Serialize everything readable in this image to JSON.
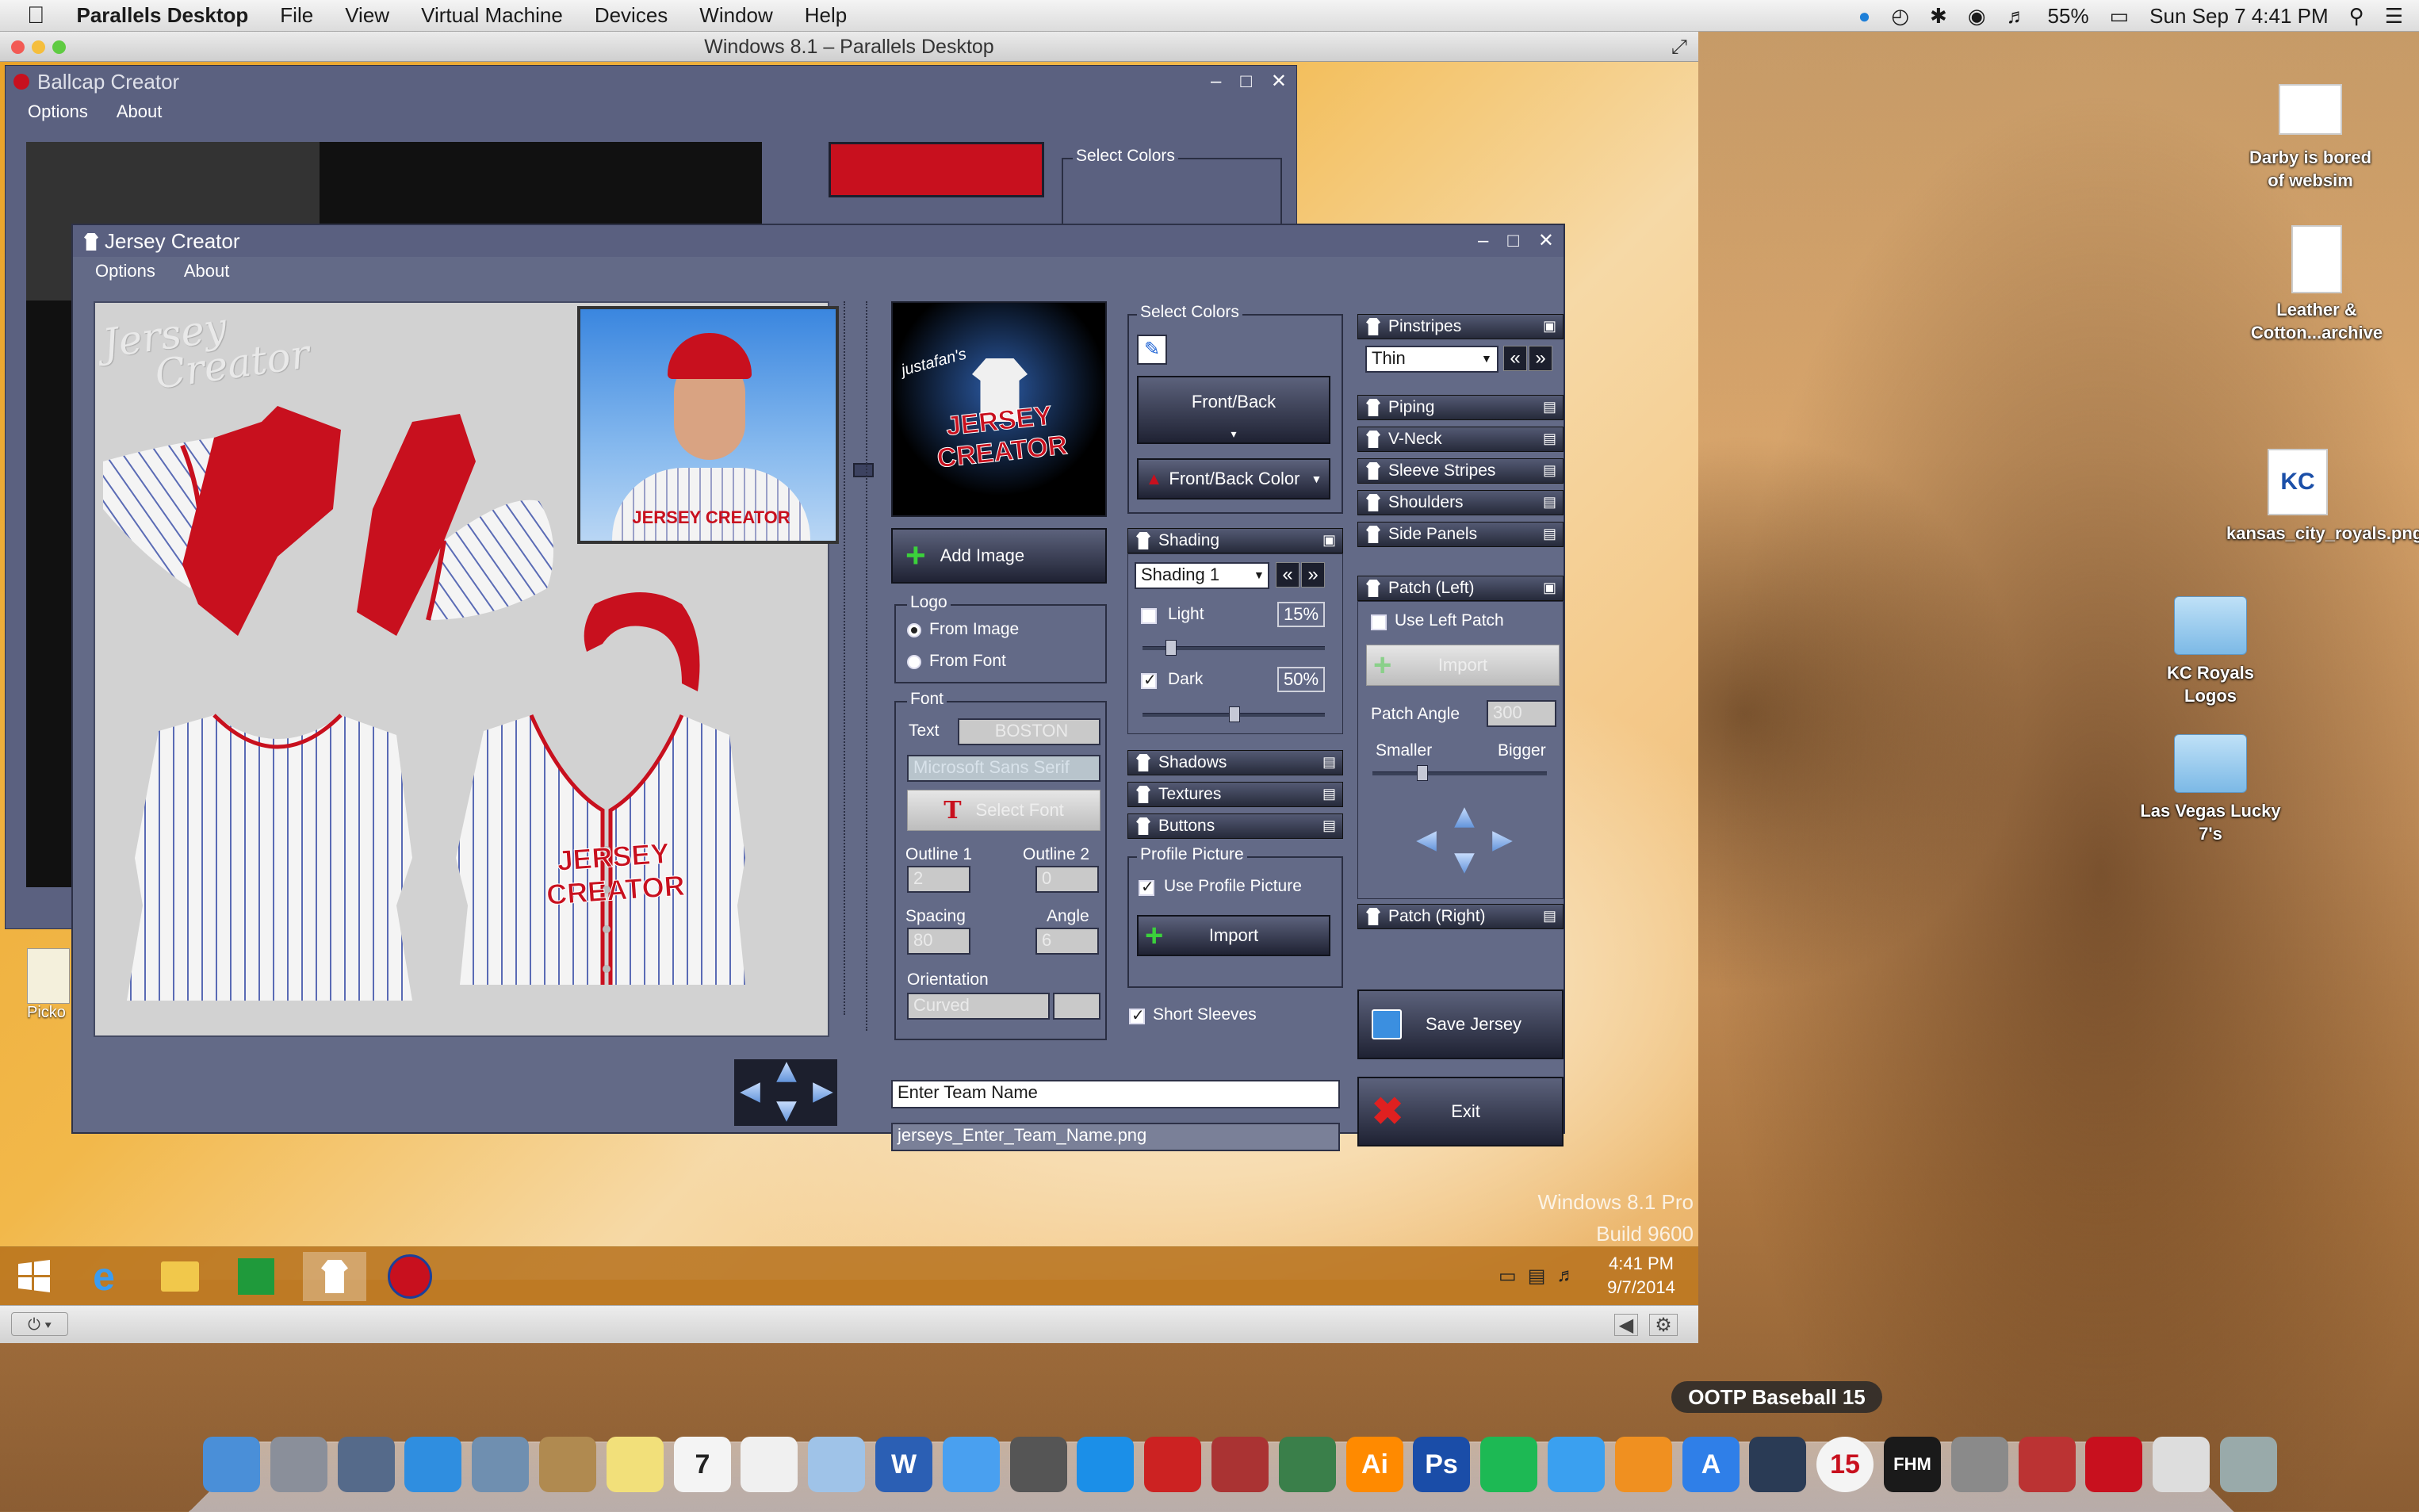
{
  "menubar": {
    "app": "Parallels Desktop",
    "items": [
      "File",
      "View",
      "Virtual Machine",
      "Devices",
      "Window",
      "Help"
    ],
    "battery": "55%",
    "clock": "Sun Sep 7  4:41 PM"
  },
  "parallels": {
    "title": "Windows 8.1 – Parallels Desktop",
    "watermark_line1": "Windows 8.1 Pro",
    "watermark_line2": "Build 9600"
  },
  "ballcap": {
    "title": "Ballcap Creator",
    "menu": [
      "Options",
      "About"
    ],
    "select_colors": "Select Colors"
  },
  "jersey": {
    "title": "Jersey Creator",
    "menu": [
      "Options",
      "About"
    ],
    "watermark_line1": "Jersey",
    "watermark_line2": "Creator",
    "player_label": "JERSEY CREATOR",
    "chest_text": "JERSEY CREATOR",
    "brand_line1": "justafan's",
    "brand_line2": "JERSEY CREATOR",
    "add_image": "Add Image",
    "logo": {
      "label": "Logo",
      "from_image": "From Image",
      "from_font": "From Font"
    },
    "font": {
      "label": "Font",
      "text_label": "Text",
      "text_value": "BOSTON",
      "font_name": "Microsoft Sans Serif",
      "select_font": "Select Font",
      "outline1_label": "Outline 1",
      "outline1_value": "2",
      "outline2_label": "Outline 2",
      "outline2_value": "0",
      "spacing_label": "Spacing",
      "spacing_value": "80",
      "angle_label": "Angle",
      "angle_value": "6",
      "orientation_label": "Orientation",
      "orientation_value": "Curved"
    },
    "colors": {
      "label": "Select Colors",
      "front_back": "Front/Back",
      "front_back_color": "Front/Back Color"
    },
    "shading": {
      "header": "Shading",
      "value": "Shading 1",
      "light_label": "Light",
      "light_value": "15%",
      "light_level": 0.15,
      "dark_label": "Dark",
      "dark_value": "50%",
      "dark_level": 0.5
    },
    "sections_mid": [
      "Shadows",
      "Textures",
      "Buttons"
    ],
    "profile": {
      "label": "Profile Picture",
      "use_profile": "Use Profile Picture",
      "import": "Import"
    },
    "short_sleeves": "Short Sleeves",
    "pinstripes": {
      "header": "Pinstripes",
      "value": "Thin"
    },
    "sections_right": [
      "Piping",
      "V-Neck",
      "Sleeve Stripes",
      "Shoulders",
      "Side Panels"
    ],
    "patch_left": {
      "header": "Patch (Left)",
      "use_left": "Use Left Patch",
      "import": "Import",
      "angle_label": "Patch Angle",
      "angle_value": "300",
      "smaller": "Smaller",
      "bigger": "Bigger"
    },
    "patch_right": "Patch (Right)",
    "save": "Save Jersey",
    "exit": "Exit",
    "team_name": "Enter Team Name",
    "filename": "jerseys_Enter_Team_Name.png"
  },
  "taskbar": {
    "time": "4:41 PM",
    "date": "9/7/2014"
  },
  "desktop_partial_label": "Picko",
  "desktop_icons": [
    {
      "label": "Darby is bored of websim"
    },
    {
      "label": "Leather & Cotton...archive"
    },
    {
      "label": "kansas_city_royals.png"
    },
    {
      "label": "KC Royals Logos"
    },
    {
      "label": "Las Vegas Lucky 7's"
    }
  ],
  "dock": {
    "tooltip": "OOTP Baseball 15",
    "calendar_day": "7",
    "ootp_badge": "15",
    "icons": [
      "finder-icon",
      "launchpad-icon",
      "mission-control-icon",
      "safari-icon",
      "mail-icon",
      "contacts-icon",
      "notes-icon",
      "calendar-icon",
      "reminders-icon",
      "preview-icon",
      "word-icon",
      "messages-icon",
      "facetime-icon",
      "teamviewer-icon",
      "parallels-icon",
      "photo-icon",
      "media-icon",
      "illustrator-icon",
      "photoshop-icon",
      "spotify-icon",
      "itunes-icon",
      "ibooks-icon",
      "app-store-icon",
      "steam-icon",
      "ootp-icon",
      "fhm-icon",
      "system-prefs-icon",
      "game-icon",
      "jersey-app-icon",
      "document-icon",
      "trash-icon"
    ]
  },
  "colors": {
    "window_bg": "#636a87",
    "accent_red": "#c8101e",
    "dark_panel": "#1c1f2d"
  }
}
